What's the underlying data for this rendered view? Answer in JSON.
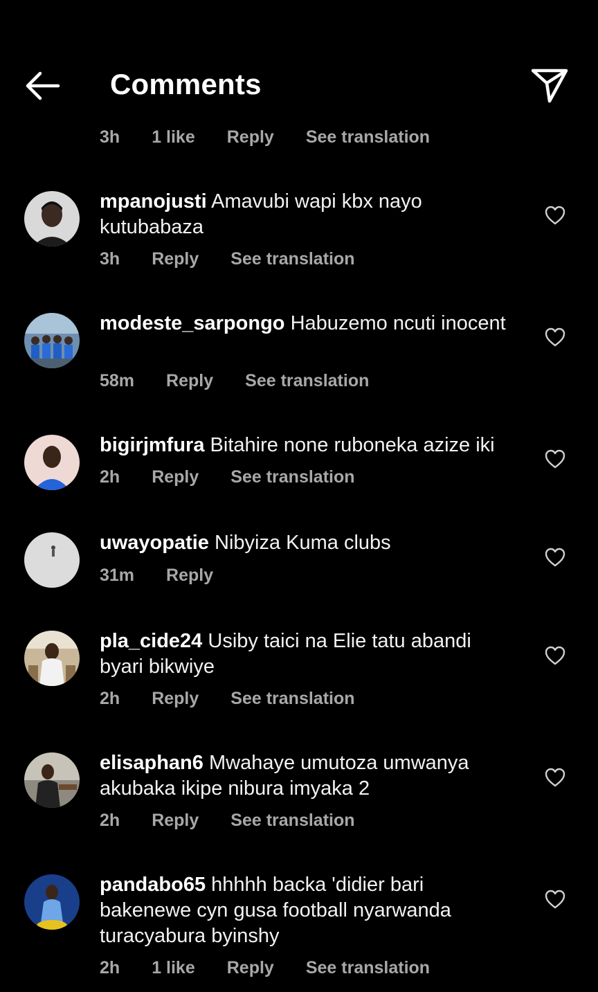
{
  "header": {
    "title": "Comments",
    "back_icon": "arrow-left-icon",
    "send_icon": "paper-plane-icon"
  },
  "previous_meta": {
    "time": "3h",
    "likes": "1 like",
    "reply": "Reply",
    "translate": "See translation"
  },
  "comments": [
    {
      "username": "mpanojusti",
      "text": "Amavubi wapi kbx nayo kutubabaza",
      "time": "3h",
      "likes": "",
      "reply": "Reply",
      "translate": "See translation"
    },
    {
      "username": "modeste_sarpongo",
      "text": "Habuzemo ncuti inocent",
      "time": "58m",
      "likes": "",
      "reply": "Reply",
      "translate": "See translation"
    },
    {
      "username": "bigirjmfura",
      "text": "Bitahire none ruboneka azize iki",
      "time": "2h",
      "likes": "",
      "reply": "Reply",
      "translate": "See translation"
    },
    {
      "username": "uwayopatie",
      "text": "Nibyiza Kuma clubs",
      "time": "31m",
      "likes": "",
      "reply": "Reply",
      "translate": ""
    },
    {
      "username": "pla_cide24",
      "text": "Usiby taici na Elie tatu abandi byari bikwiye",
      "time": "2h",
      "likes": "",
      "reply": "Reply",
      "translate": "See translation"
    },
    {
      "username": "elisaphan6",
      "text": "Mwahaye umutoza umwanya akubaka ikipe nibura imyaka 2",
      "time": "2h",
      "likes": "",
      "reply": "Reply",
      "translate": "See translation"
    },
    {
      "username": "pandabo65",
      "text": "hhhhh backa 'didier bari bakenewe cyn gusa football nyarwanda turacyabura byinshy",
      "time": "2h",
      "likes": "1 like",
      "reply": "Reply",
      "translate": "See translation"
    }
  ],
  "colors": {
    "background": "#000000",
    "text": "#ffffff",
    "meta": "#a8a8a8"
  }
}
